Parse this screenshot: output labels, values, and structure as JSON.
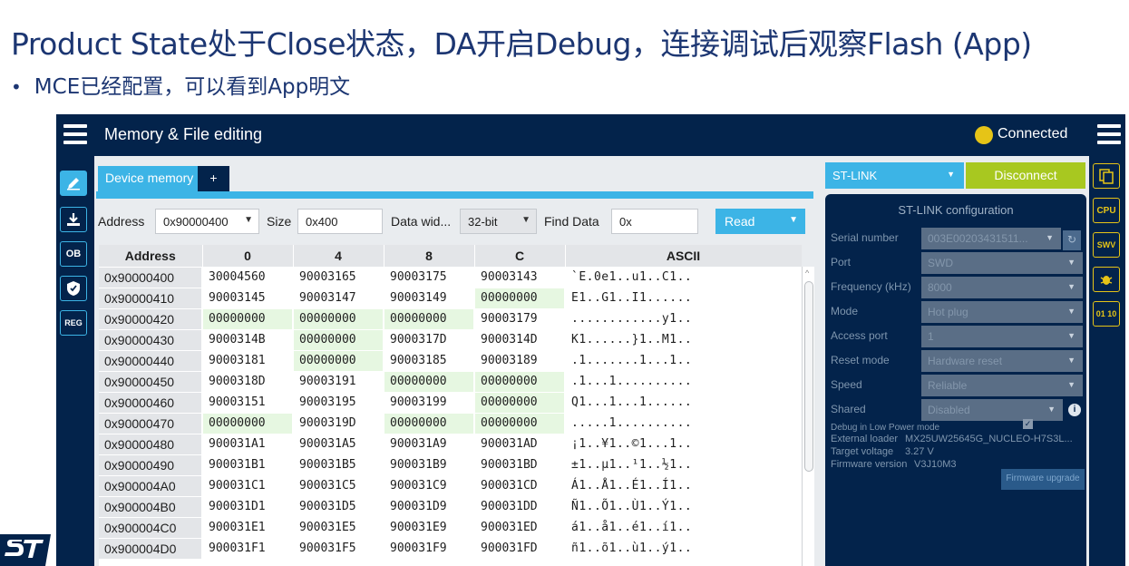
{
  "slide": {
    "title": "Product State处于Close状态，DA开启Debug，连接调试后观察Flash (App)",
    "bullet": "MCE已经配置，可以看到App明文"
  },
  "header": {
    "title": "Memory & File editing",
    "status": "Connected",
    "status_color": "#e6c417"
  },
  "left_nav": [
    {
      "name": "edit-icon",
      "label": ""
    },
    {
      "name": "download-icon",
      "label": ""
    },
    {
      "name": "option-bytes-icon",
      "label": "OB"
    },
    {
      "name": "security-shield-icon",
      "label": ""
    },
    {
      "name": "registers-icon",
      "label": "REG"
    }
  ],
  "right_nav": [
    {
      "name": "copy-icon",
      "label": ""
    },
    {
      "name": "cpu-icon",
      "label": "CPU"
    },
    {
      "name": "swv-icon",
      "label": "SWV"
    },
    {
      "name": "bug-icon",
      "label": ""
    },
    {
      "name": "binary-icon",
      "label": "01 10"
    }
  ],
  "tabs": {
    "active": "Device memory",
    "add": "+"
  },
  "toolbar": {
    "address_label": "Address",
    "address_value": "0x90000400",
    "size_label": "Size",
    "size_value": "0x400",
    "width_label": "Data wid...",
    "width_value": "32-bit",
    "find_label": "Find Data",
    "find_value": "0x",
    "read_label": "Read"
  },
  "memory_table": {
    "headers": [
      "Address",
      "0",
      "4",
      "8",
      "C",
      "ASCII"
    ],
    "rows": [
      [
        "0x90000400",
        "30004560",
        "90003165",
        "90003175",
        "90003143",
        "`E.0e1..u1..C1.."
      ],
      [
        "0x90000410",
        "90003145",
        "90003147",
        "90003149",
        "00000000",
        "E1..G1..I1......"
      ],
      [
        "0x90000420",
        "00000000",
        "00000000",
        "00000000",
        "90003179",
        "............y1.."
      ],
      [
        "0x90000430",
        "9000314B",
        "00000000",
        "9000317D",
        "9000314D",
        "K1......}1..M1.."
      ],
      [
        "0x90000440",
        "90003181",
        "00000000",
        "90003185",
        "90003189",
        ".1.......1...1.."
      ],
      [
        "0x90000450",
        "9000318D",
        "90003191",
        "00000000",
        "00000000",
        ".1...1.........."
      ],
      [
        "0x90000460",
        "90003151",
        "90003195",
        "90003199",
        "00000000",
        "Q1...1...1......"
      ],
      [
        "0x90000470",
        "00000000",
        "9000319D",
        "00000000",
        "00000000",
        ".....1.........."
      ],
      [
        "0x90000480",
        "900031A1",
        "900031A5",
        "900031A9",
        "900031AD",
        "¡1..¥1..©1...1.."
      ],
      [
        "0x90000490",
        "900031B1",
        "900031B5",
        "900031B9",
        "900031BD",
        "±1..µ1..¹1..½1.."
      ],
      [
        "0x900004A0",
        "900031C1",
        "900031C5",
        "900031C9",
        "900031CD",
        "Á1..Å1..É1..Í1.."
      ],
      [
        "0x900004B0",
        "900031D1",
        "900031D5",
        "900031D9",
        "900031DD",
        "Ñ1..Õ1..Ù1..Ý1.."
      ],
      [
        "0x900004C0",
        "900031E1",
        "900031E5",
        "900031E9",
        "900031ED",
        "á1..å1..é1..í1.."
      ],
      [
        "0x900004D0",
        "900031F1",
        "900031F5",
        "900031F9",
        "900031FD",
        "ñ1..õ1..ù1..ý1.."
      ]
    ]
  },
  "stlink": {
    "probe": "ST-LINK",
    "disconnect_label": "Disconnect",
    "config_title": "ST-LINK configuration",
    "fields": [
      {
        "label": "Serial number",
        "value": "003E00203431511..."
      },
      {
        "label": "Port",
        "value": "SWD"
      },
      {
        "label": "Frequency (kHz)",
        "value": "8000"
      },
      {
        "label": "Mode",
        "value": "Hot plug"
      },
      {
        "label": "Access port",
        "value": "1"
      },
      {
        "label": "Reset mode",
        "value": "Hardware reset"
      },
      {
        "label": "Speed",
        "value": "Reliable"
      },
      {
        "label": "Shared",
        "value": "Disabled"
      }
    ],
    "low_power_label": "Debug in Low Power mode",
    "loader_label": "External loader",
    "loader_value": "MX25UW25645G_NUCLEO-H7S3L...",
    "voltage_label": "Target voltage",
    "voltage_value": "3.27 V",
    "firmware_label": "Firmware version",
    "firmware_value": "V3J10M3",
    "firmware_button": "Firmware upgrade"
  }
}
